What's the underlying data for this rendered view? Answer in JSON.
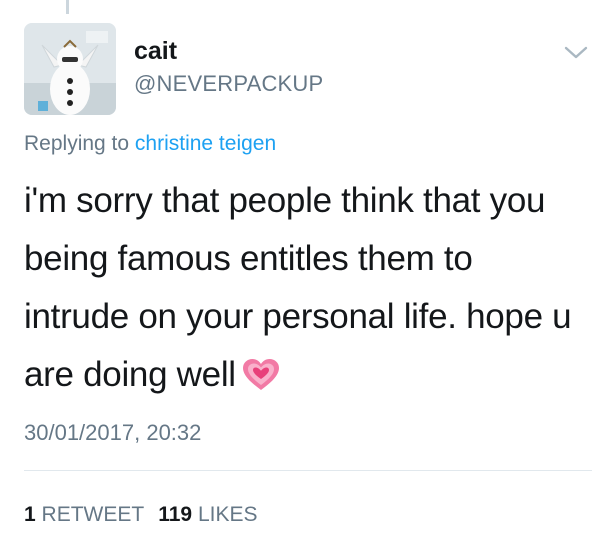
{
  "tweet": {
    "author": {
      "name": "cait",
      "handle": "@NEVERPACKUP"
    },
    "replying_label": "Replying to",
    "replying_to": "christine teigen",
    "text": "i'm sorry that people think that you being famous entitles them to intrude on your personal life. hope u are doing well",
    "emoji_icon": "growing-heart-icon",
    "timestamp": "30/01/2017, 20:32",
    "retweets_count": "1",
    "retweets_label": "RETWEET",
    "likes_count": "119",
    "likes_label": "LIKES"
  },
  "colors": {
    "link": "#1da1f2",
    "secondary_text": "#657786",
    "primary_text": "#14171a",
    "heart": "#e8407a"
  }
}
